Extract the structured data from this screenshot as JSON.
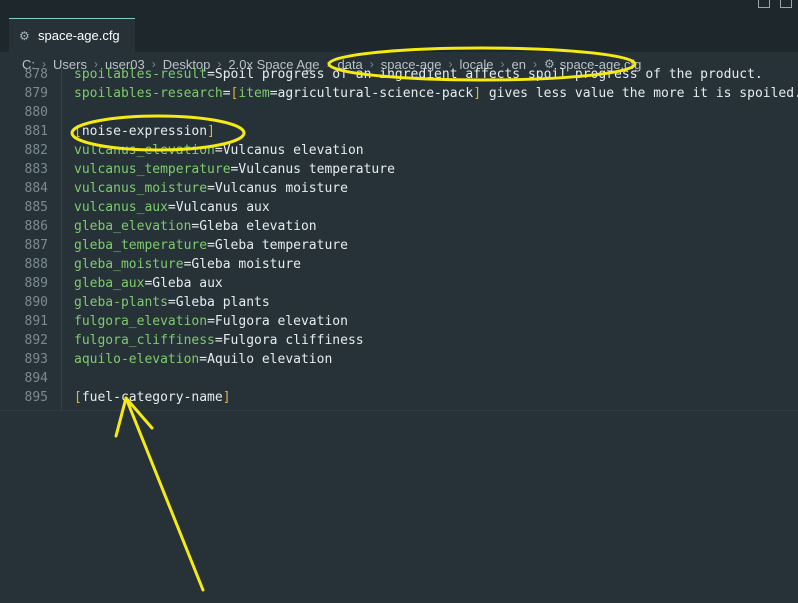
{
  "tab": {
    "label": "space-age.cfg"
  },
  "breadcrumb": {
    "items": [
      "C:",
      "Users",
      "user03",
      "Desktop",
      "2.0x Space Age",
      "data",
      "space-age",
      "locale",
      "en",
      "space-age.cfg"
    ]
  },
  "editor": {
    "lines": [
      {
        "num": "878",
        "key": "spoilables-result",
        "rest": "Spoil progress of an ingredient affects spoil progress of the product."
      },
      {
        "num": "879",
        "key": "spoilables-research",
        "rest": "[item=agricultural-science-pack] gives less value the more it is spoiled."
      },
      {
        "num": "880",
        "key": "",
        "rest": ""
      },
      {
        "num": "881",
        "section": "noise-expression"
      },
      {
        "num": "882",
        "key": "vulcanus_elevation",
        "rest": "Vulcanus elevation"
      },
      {
        "num": "883",
        "key": "vulcanus_temperature",
        "rest": "Vulcanus temperature"
      },
      {
        "num": "884",
        "key": "vulcanus_moisture",
        "rest": "Vulcanus moisture"
      },
      {
        "num": "885",
        "key": "vulcanus_aux",
        "rest": "Vulcanus aux"
      },
      {
        "num": "886",
        "key": "gleba_elevation",
        "rest": "Gleba elevation"
      },
      {
        "num": "887",
        "key": "gleba_temperature",
        "rest": "Gleba temperature"
      },
      {
        "num": "888",
        "key": "gleba_moisture",
        "rest": "Gleba moisture"
      },
      {
        "num": "889",
        "key": "gleba_aux",
        "rest": "Gleba aux"
      },
      {
        "num": "890",
        "key": "gleba-plants",
        "rest": "Gleba plants"
      },
      {
        "num": "891",
        "key": "fulgora_elevation",
        "rest": "Fulgora elevation"
      },
      {
        "num": "892",
        "key": "fulgora_cliffiness",
        "rest": "Fulgora cliffiness"
      },
      {
        "num": "893",
        "key": "aquilo-elevation",
        "rest": "Aquilo elevation"
      },
      {
        "num": "894",
        "key": "",
        "rest": ""
      },
      {
        "num": "895",
        "section": "fuel-category-name"
      }
    ]
  },
  "colors": {
    "background": "#263238",
    "key": "#7fca6e",
    "bracket": "#e0b23b",
    "annotation": "#f5ea14"
  }
}
